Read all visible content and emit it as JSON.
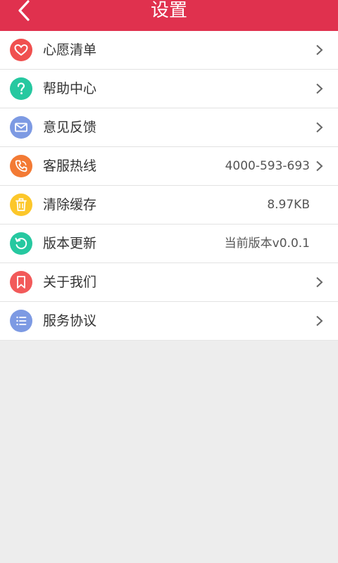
{
  "header": {
    "title": "设置"
  },
  "colors": {
    "header_bg": "#e0314e",
    "wishlist_icon": "#f0504f",
    "help_icon": "#26c8a0",
    "feedback_icon": "#7d9ae3",
    "hotline_icon": "#f37a34",
    "cache_icon": "#fcc72a",
    "update_icon": "#26c8a0",
    "about_icon": "#f25a5a",
    "agreement_icon": "#7d9ae3"
  },
  "settings": {
    "items": [
      {
        "label": "心愿清单",
        "icon": "heart-icon"
      },
      {
        "label": "帮助中心",
        "icon": "question-icon"
      },
      {
        "label": "意见反馈",
        "icon": "envelope-icon"
      },
      {
        "label": "客服热线",
        "icon": "phone-icon",
        "value": "4000-593-693"
      },
      {
        "label": "清除缓存",
        "icon": "trash-icon",
        "value": "8.97KB"
      },
      {
        "label": "版本更新",
        "icon": "refresh-icon",
        "value": "当前版本v0.0.1"
      },
      {
        "label": "关于我们",
        "icon": "bookmark-icon"
      },
      {
        "label": "服务协议",
        "icon": "list-icon"
      }
    ]
  }
}
